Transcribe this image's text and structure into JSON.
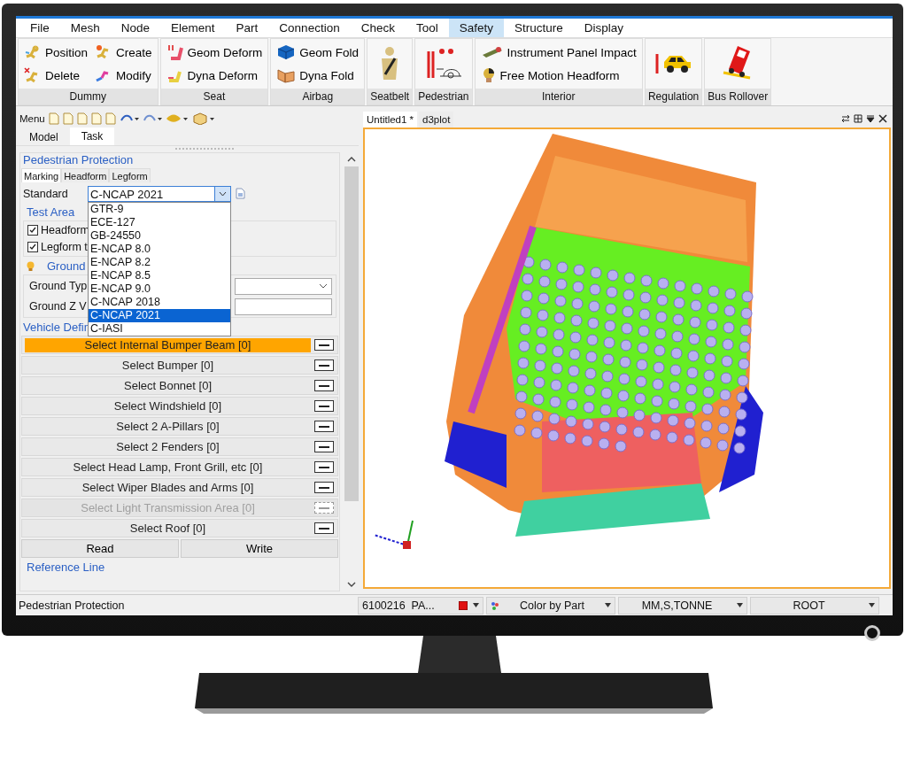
{
  "menu": [
    {
      "label": "File",
      "selected": false
    },
    {
      "label": "Mesh",
      "selected": false
    },
    {
      "label": "Node",
      "selected": false
    },
    {
      "label": "Element",
      "selected": false
    },
    {
      "label": "Part",
      "selected": false
    },
    {
      "label": "Connection",
      "selected": false
    },
    {
      "label": "Check",
      "selected": false
    },
    {
      "label": "Tool",
      "selected": false
    },
    {
      "label": "Safety",
      "selected": true
    },
    {
      "label": "Structure",
      "selected": false
    },
    {
      "label": "Display",
      "selected": false
    }
  ],
  "ribbon": [
    {
      "kind": "small",
      "label": "Dummy",
      "items": [
        "Position",
        "Create",
        "Delete",
        "Modify"
      ]
    },
    {
      "kind": "small",
      "label": "Seat",
      "items": [
        "Geom Deform",
        "Dyna Deform"
      ]
    },
    {
      "kind": "small",
      "label": "Airbag",
      "items": [
        "Geom Fold",
        "Dyna Fold"
      ]
    },
    {
      "kind": "large",
      "label": "Seatbelt"
    },
    {
      "kind": "large",
      "label": "Pedestrian"
    },
    {
      "kind": "small",
      "label": "Interior",
      "items": [
        "Instrument Panel Impact",
        "Free Motion Headform"
      ]
    },
    {
      "kind": "large",
      "label": "Regulation"
    },
    {
      "kind": "large",
      "label": "Bus Rollover"
    }
  ],
  "left_toolbar": {
    "menu_label": "Menu"
  },
  "panel_tabs": [
    {
      "label": "Model",
      "selected": false
    },
    {
      "label": "Task",
      "selected": true
    }
  ],
  "pedestrian_protection": {
    "title": "Pedestrian Protection",
    "tabs": [
      {
        "label": "Marking",
        "selected": true
      },
      {
        "label": "Headform",
        "selected": false
      },
      {
        "label": "Legform",
        "selected": false
      }
    ],
    "standard": {
      "label": "Standard",
      "value": "C-NCAP 2021",
      "expanded": true,
      "options": [
        {
          "label": "GTR-9",
          "selected": false
        },
        {
          "label": "ECE-127",
          "selected": false
        },
        {
          "label": "GB-24550",
          "selected": false
        },
        {
          "label": "E-NCAP 8.0",
          "selected": false
        },
        {
          "label": "E-NCAP 8.2",
          "selected": false
        },
        {
          "label": "E-NCAP 8.5",
          "selected": false
        },
        {
          "label": "E-NCAP 9.0",
          "selected": false
        },
        {
          "label": "C-NCAP 2018",
          "selected": false
        },
        {
          "label": "C-NCAP 2021",
          "selected": true
        },
        {
          "label": "C-IASI",
          "selected": false
        }
      ]
    },
    "test_area": {
      "title": "Test Area",
      "checkboxes": [
        {
          "label": "Headform",
          "checked": true
        },
        {
          "label": "Legform t",
          "checked": true
        }
      ]
    },
    "ground": {
      "title": "Ground",
      "type_label": "Ground Typ",
      "z_label": "Ground Z V"
    },
    "vehicle_definition": {
      "title": "Vehicle Defin",
      "rows": [
        {
          "label": "Select Internal Bumper Beam [0]",
          "highlighted": true,
          "disabled": false
        },
        {
          "label": "Select Bumper [0]",
          "highlighted": false,
          "disabled": false
        },
        {
          "label": "Select Bonnet [0]",
          "highlighted": false,
          "disabled": false
        },
        {
          "label": "Select Windshield [0]",
          "highlighted": false,
          "disabled": false
        },
        {
          "label": "Select 2 A-Pillars [0]",
          "highlighted": false,
          "disabled": false
        },
        {
          "label": "Select 2 Fenders [0]",
          "highlighted": false,
          "disabled": false
        },
        {
          "label": "Select Head Lamp, Front Grill, etc [0]",
          "highlighted": false,
          "disabled": false
        },
        {
          "label": "Select Wiper Blades and Arms [0]",
          "highlighted": false,
          "disabled": false
        },
        {
          "label": "Select Light Transmission Area [0]",
          "highlighted": false,
          "disabled": true
        },
        {
          "label": "Select Roof [0]",
          "highlighted": false,
          "disabled": false
        }
      ]
    },
    "buttons": [
      "Read",
      "Write"
    ],
    "reference_line": {
      "title": "Reference Line"
    }
  },
  "viewport": {
    "tabs": [
      {
        "label": "Untitled1 *",
        "selected": true
      },
      {
        "label": "d3plot",
        "selected": false
      }
    ]
  },
  "status_bar": {
    "message": "Pedestrian Protection",
    "part": "6100216  PA...",
    "color_mode": "Color by Part",
    "units": "MM,S,TONNE",
    "root": "ROOT"
  }
}
